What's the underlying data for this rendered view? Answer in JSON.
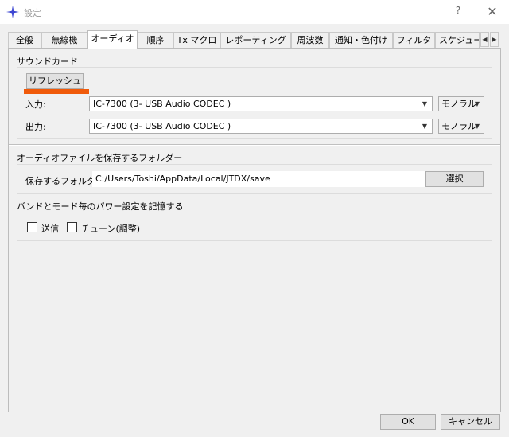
{
  "window": {
    "title": "設定",
    "help_glyph": "?",
    "close_glyph": "✕",
    "accent_color": "#3c46d2"
  },
  "tabs": [
    {
      "label": "全般",
      "active": false
    },
    {
      "label": "無線機",
      "active": false
    },
    {
      "label": "オーディオ",
      "active": true
    },
    {
      "label": "順序",
      "active": false
    },
    {
      "label": "Tx マクロ",
      "active": false
    },
    {
      "label": "レポーティング",
      "active": false
    },
    {
      "label": "周波数",
      "active": false
    },
    {
      "label": "通知・色付け",
      "active": false
    },
    {
      "label": "フィルタ",
      "active": false
    },
    {
      "label": "スケジューラ",
      "active": false
    }
  ],
  "tab_scroll": {
    "left": "◀",
    "right": "▶"
  },
  "soundcard": {
    "section_label": "サウンドカード",
    "refresh_label": "リフレッシュ",
    "input_label": "入力:",
    "input_device": "IC-7300 (3- USB Audio CODEC )",
    "input_channel": "モノラル",
    "output_label": "出力:",
    "output_device": "IC-7300 (3- USB Audio CODEC )",
    "output_channel": "モノラル"
  },
  "save_folder": {
    "section_label": "オーディオファイルを保存するフォルダー",
    "folder_label": "保存するフォルダー:",
    "folder_path": "C:/Users/Toshi/AppData/Local/JTDX/save",
    "select_label": "選択"
  },
  "power": {
    "section_label": "バンドとモード毎のパワー設定を記憶する",
    "transmit_label": "送信",
    "transmit_checked": false,
    "tune_label": "チューン(調整)",
    "tune_checked": false
  },
  "footer": {
    "ok_label": "OK",
    "cancel_label": "キャンセル"
  },
  "annotation": {
    "color": "#f05a0a"
  },
  "icons": {
    "dropdown": "▼"
  }
}
